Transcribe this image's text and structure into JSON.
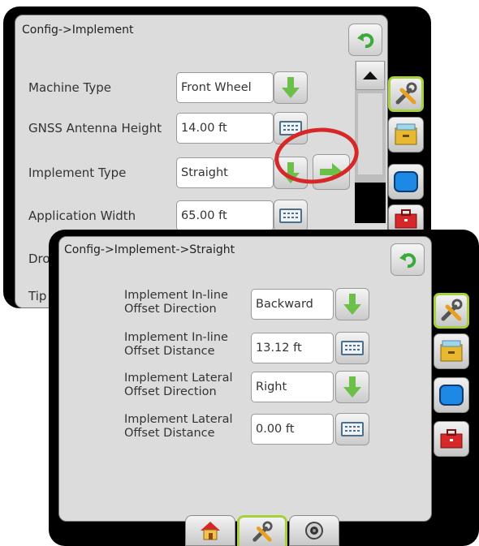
{
  "back_panel": {
    "title": "Config->Implement",
    "rows": [
      {
        "label": "Machine Type",
        "value": "Front Wheel"
      },
      {
        "label": "GNSS Antenna Height",
        "value": "14.00 ft"
      },
      {
        "label": "Implement Type",
        "value": "Straight"
      },
      {
        "label": "Application Width",
        "value": "65.00 ft"
      },
      {
        "label": "Drop"
      },
      {
        "label": "Tip S"
      }
    ]
  },
  "front_panel": {
    "title": "Config->Implement->Straight",
    "rows": [
      {
        "label_line1": "Implement In-line",
        "label_line2": "Offset Direction",
        "value": "Backward"
      },
      {
        "label_line1": "Implement In-line",
        "label_line2": "Offset Distance",
        "value": "13.12 ft"
      },
      {
        "label_line1": "Implement Lateral",
        "label_line2": "Offset Direction",
        "value": "Right"
      },
      {
        "label_line1": "Implement Lateral",
        "label_line2": "Offset Distance",
        "value": "0.00 ft"
      }
    ]
  },
  "colors": {
    "highlight_circle": "#d62828",
    "green_arrow": "#6cc04a",
    "active_outline": "#a7d13c",
    "panel_bg": "#dcdcdc"
  },
  "icons": {
    "back": "back-arrow-icon",
    "dropdown": "green-down-arrow-icon",
    "keypad": "keyboard-icon",
    "next": "green-right-arrow-icon",
    "side": [
      "tools-icon",
      "data-box-icon",
      "display-icon",
      "toolbox-icon"
    ],
    "bottom": [
      "home-icon",
      "tools-icon",
      "camera-icon"
    ]
  }
}
